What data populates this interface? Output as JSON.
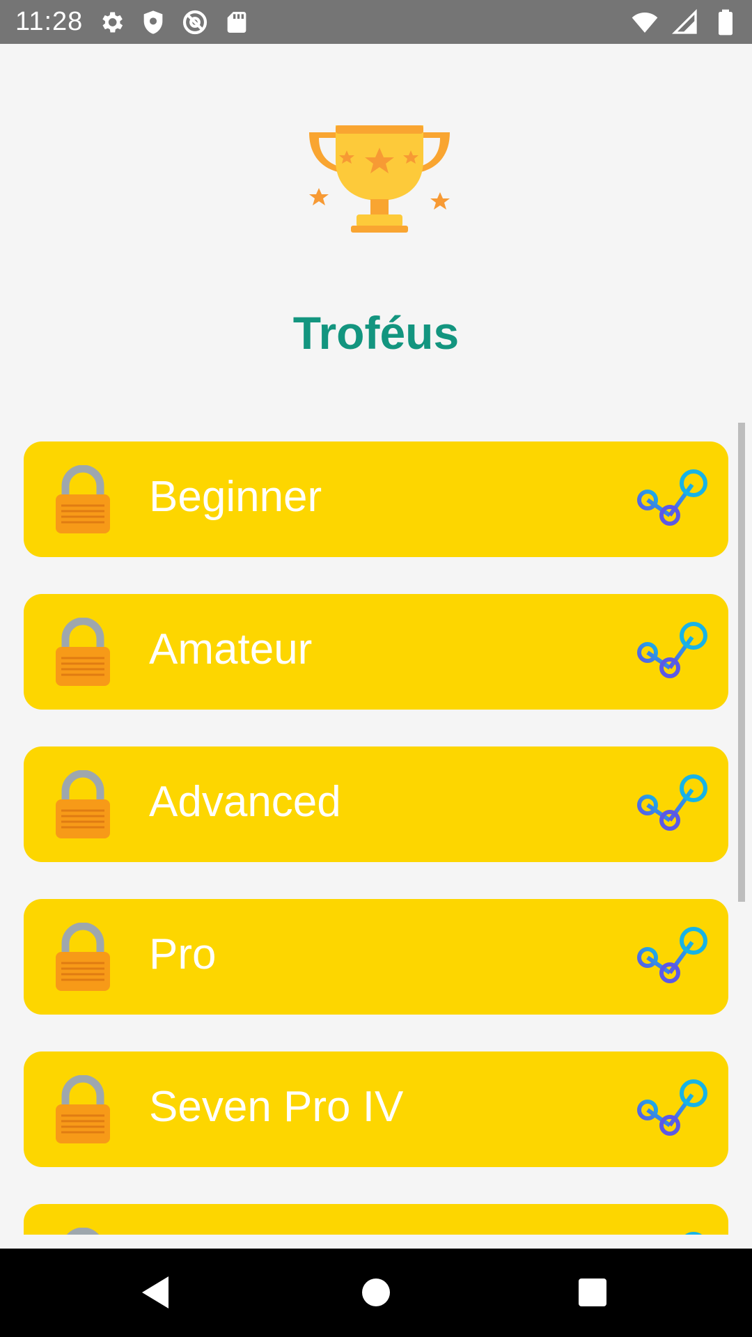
{
  "status_bar": {
    "time": "11:28",
    "left_icons": [
      "settings-icon",
      "shield-icon",
      "at-sign-icon",
      "sd-card-icon"
    ],
    "right_icons": [
      "wifi-icon",
      "signal-icon",
      "battery-icon"
    ]
  },
  "header": {
    "icon": "trophy-icon",
    "title": "Troféus"
  },
  "trophies": [
    {
      "label": "Beginner",
      "locked": true
    },
    {
      "label": "Amateur",
      "locked": true
    },
    {
      "label": "Advanced",
      "locked": true
    },
    {
      "label": "Pro",
      "locked": true
    },
    {
      "label": "Seven Pro IV",
      "locked": true
    },
    {
      "label": "",
      "locked": true
    }
  ],
  "colors": {
    "card": "#fdd600",
    "title": "#13957f",
    "status_bar": "#757575"
  },
  "nav_bar": {
    "buttons": [
      "back-icon",
      "home-icon",
      "recents-icon"
    ]
  }
}
